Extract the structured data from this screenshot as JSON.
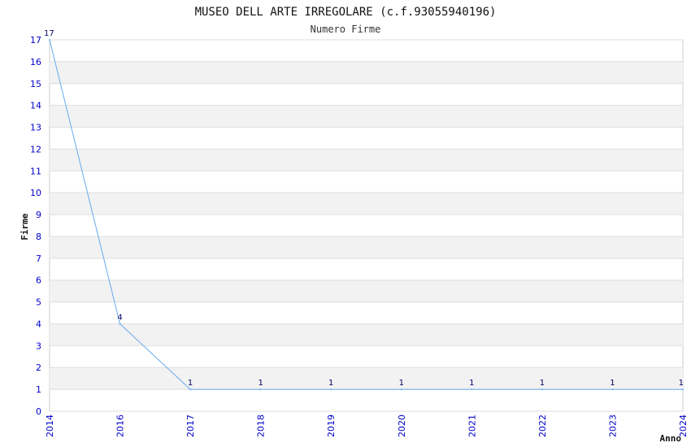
{
  "chart_data": {
    "type": "line",
    "title": "MUSEO DELL ARTE IRREGOLARE (c.f.93055940196)",
    "subtitle": "Numero Firme",
    "xlabel": "Anno",
    "ylabel": "Firme",
    "categories": [
      "2014",
      "2016",
      "2017",
      "2018",
      "2019",
      "2020",
      "2021",
      "2022",
      "2023",
      "2024"
    ],
    "values": [
      17,
      4,
      1,
      1,
      1,
      1,
      1,
      1,
      1,
      1
    ],
    "ylim": [
      0,
      17
    ],
    "yticks": [
      0,
      1,
      2,
      3,
      4,
      5,
      6,
      7,
      8,
      9,
      10,
      11,
      12,
      13,
      14,
      15,
      16,
      17
    ],
    "grid": true,
    "colors": {
      "line": "#66aaee",
      "band": "#f2f2f2",
      "grid": "#dddddd",
      "tick_text": "#0000cc"
    }
  }
}
